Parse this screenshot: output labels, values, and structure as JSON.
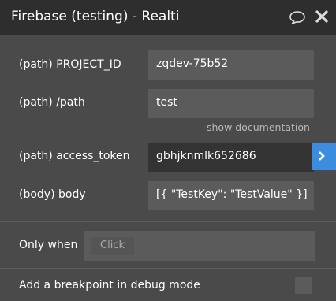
{
  "header": {
    "title": "Firebase (testing) - Realti",
    "icons": [
      "comment-icon",
      "close-icon"
    ]
  },
  "params": [
    {
      "label": "(path) PROJECT_ID",
      "value": "zqdev-75b52"
    },
    {
      "label": "(path) /path",
      "value": "test"
    },
    {
      "label": "(path) access_token",
      "value": "gbhjknmlk652686"
    },
    {
      "label": "(body) body",
      "value": "[{ \"TestKey\": \"TestValue\" }]"
    }
  ],
  "show_documentation": "show documentation",
  "only_when": {
    "label": "Only when",
    "placeholder": "Click"
  },
  "breakpoint": {
    "label": "Add a breakpoint in debug mode",
    "checked": false
  },
  "colors": {
    "header_bg": "#2e2e2e",
    "panel_bg": "#4a4a4a",
    "field_bg": "#5b5b5b",
    "active_field_bg": "#333333",
    "accent": "#3c8de0"
  }
}
